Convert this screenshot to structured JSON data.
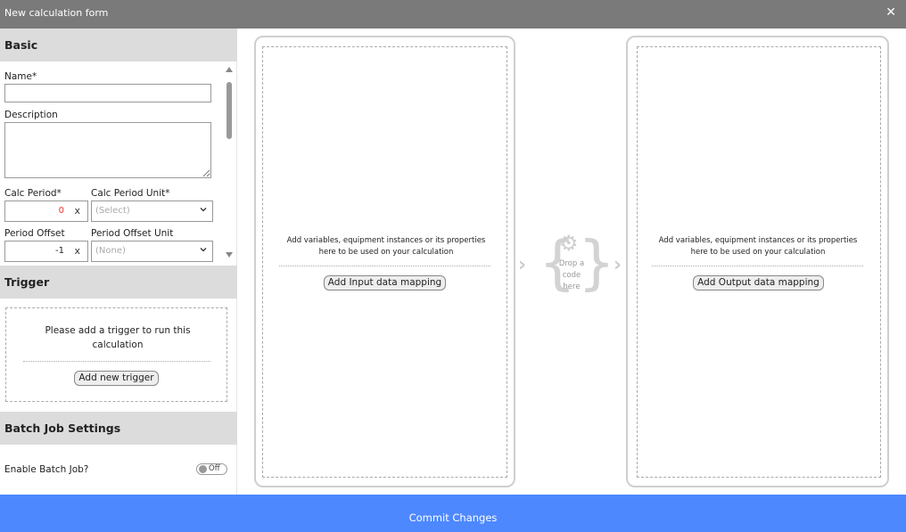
{
  "window": {
    "title": "New calculation form",
    "close_icon": "close-icon"
  },
  "basic": {
    "header": "Basic",
    "name_label": "Name*",
    "name_value": "",
    "description_label": "Description",
    "description_value": "",
    "calc_period_label": "Calc Period*",
    "calc_period_value": "0",
    "calc_period_clear": "x",
    "calc_period_unit_label": "Calc Period Unit*",
    "calc_period_unit_value": "(Select)",
    "period_offset_label": "Period Offset",
    "period_offset_value": "-1",
    "period_offset_clear": "x",
    "period_offset_unit_label": "Period Offset Unit",
    "period_offset_unit_value": "(None)"
  },
  "trigger": {
    "header": "Trigger",
    "message": "Please add a trigger to run this calculation",
    "add_button": "Add new trigger"
  },
  "batch": {
    "header": "Batch Job Settings",
    "enable_label": "Enable Batch Job?",
    "toggle_state": "Off"
  },
  "input_panel": {
    "message": "Add variables, equipment instances or its properties here to be used on your calculation",
    "button": "Add Input data mapping"
  },
  "code_drop": {
    "text": "Drop a code here",
    "icon": "gear-icon"
  },
  "output_panel": {
    "message": "Add variables, equipment instances or its properties here to be used on your calculation",
    "button": "Add Output data mapping"
  },
  "footer": {
    "commit_label": "Commit Changes"
  },
  "colors": {
    "accent": "#4d88ff",
    "titlebar": "#7a7a7a",
    "section_header": "#dcdcdc",
    "error_value": "#e53935"
  }
}
